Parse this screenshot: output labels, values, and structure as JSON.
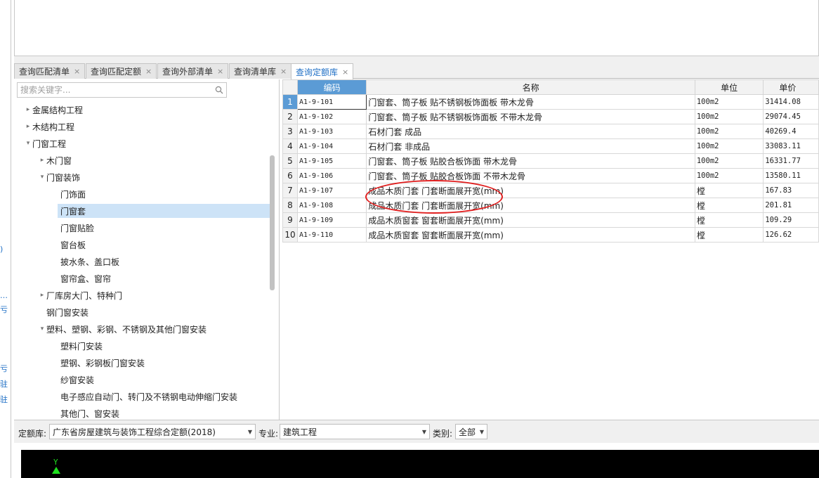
{
  "tabs": [
    {
      "label": "查询匹配清单",
      "active": false
    },
    {
      "label": "查询匹配定额",
      "active": false
    },
    {
      "label": "查询外部清单",
      "active": false
    },
    {
      "label": "查询清单库",
      "active": false
    },
    {
      "label": "查询定额库",
      "active": true
    }
  ],
  "tab_close": "×",
  "search": {
    "placeholder": "搜索关键字..."
  },
  "tree": [
    {
      "label": "金属结构工程",
      "arrow": "▸",
      "level": 1
    },
    {
      "label": "木结构工程",
      "arrow": "▸",
      "level": 1
    },
    {
      "label": "门窗工程",
      "arrow": "▾",
      "level": 1
    },
    {
      "label": "木门窗",
      "arrow": "▸",
      "level": 2
    },
    {
      "label": "门窗装饰",
      "arrow": "▾",
      "level": 2
    },
    {
      "label": "门饰面",
      "arrow": "",
      "level": 3
    },
    {
      "label": "门窗套",
      "arrow": "",
      "level": 3,
      "selected": true
    },
    {
      "label": "门窗贴脸",
      "arrow": "",
      "level": 3
    },
    {
      "label": "窗台板",
      "arrow": "",
      "level": 3
    },
    {
      "label": "披水条、盖口板",
      "arrow": "",
      "level": 3
    },
    {
      "label": "窗帘盒、窗帘",
      "arrow": "",
      "level": 3
    },
    {
      "label": "厂库房大门、特种门",
      "arrow": "▸",
      "level": 2
    },
    {
      "label": "钢门窗安装",
      "arrow": "",
      "level": 2
    },
    {
      "label": "塑料、塑钢、彩钢、不锈钢及其他门窗安装",
      "arrow": "▾",
      "level": 2
    },
    {
      "label": "塑料门安装",
      "arrow": "",
      "level": 3
    },
    {
      "label": "塑钢、彩钢板门窗安装",
      "arrow": "",
      "level": 3
    },
    {
      "label": "纱窗安装",
      "arrow": "",
      "level": 3
    },
    {
      "label": "电子感应自动门、转门及不锈钢电动伸缩门安装",
      "arrow": "",
      "level": 3
    },
    {
      "label": "其他门、窗安装",
      "arrow": "",
      "level": 3
    }
  ],
  "grid": {
    "headers": {
      "code": "编码",
      "name": "名称",
      "unit": "单位",
      "price": "单价"
    },
    "rows": [
      {
        "n": "1",
        "code": "A1-9-101",
        "name": "门窗套、筒子板 贴不锈钢板饰面板 带木龙骨",
        "unit": "100m2",
        "price": "31414.08"
      },
      {
        "n": "2",
        "code": "A1-9-102",
        "name": "门窗套、筒子板 贴不锈钢板饰面板 不带木龙骨",
        "unit": "100m2",
        "price": "29074.45"
      },
      {
        "n": "3",
        "code": "A1-9-103",
        "name": "石材门套 成品",
        "unit": "100m2",
        "price": "40269.4"
      },
      {
        "n": "4",
        "code": "A1-9-104",
        "name": "石材门套 非成品",
        "unit": "100m2",
        "price": "33083.11"
      },
      {
        "n": "5",
        "code": "A1-9-105",
        "name": "门窗套、筒子板 贴胶合板饰面 带木龙骨",
        "unit": "100m2",
        "price": "16331.77"
      },
      {
        "n": "6",
        "code": "A1-9-106",
        "name": "门窗套、筒子板 贴胶合板饰面 不带木龙骨",
        "unit": "100m2",
        "price": "13580.11"
      },
      {
        "n": "7",
        "code": "A1-9-107",
        "name": "成品木质门套 门套断面展开宽(mm)",
        "unit": "樘",
        "price": "167.83"
      },
      {
        "n": "8",
        "code": "A1-9-108",
        "name": "成品木质门套 门套断面展开宽(mm)",
        "unit": "樘",
        "price": "201.81"
      },
      {
        "n": "9",
        "code": "A1-9-109",
        "name": "成品木质窗套 窗套断面展开宽(mm)",
        "unit": "樘",
        "price": "109.29"
      },
      {
        "n": "10",
        "code": "A1-9-110",
        "name": "成品木质窗套 窗套断面展开宽(mm)",
        "unit": "樘",
        "price": "126.62"
      }
    ]
  },
  "bottom": {
    "quota_label": "定额库:",
    "quota_value": "广东省房屋建筑与装饰工程综合定额(2018)",
    "major_label": "专业:",
    "major_value": "建筑工程",
    "category_label": "类别:",
    "category_value": "全部"
  },
  "cad": {
    "axis_label": "Y"
  },
  "side_marks": [
    ")",
    "…",
    "亏",
    "亏",
    "驻",
    "驻"
  ],
  "colors": {
    "accent": "#1f6fc5",
    "selection": "#cde3f7",
    "header_selected": "#5b9bd5",
    "annotation_circle": "#e02020"
  }
}
